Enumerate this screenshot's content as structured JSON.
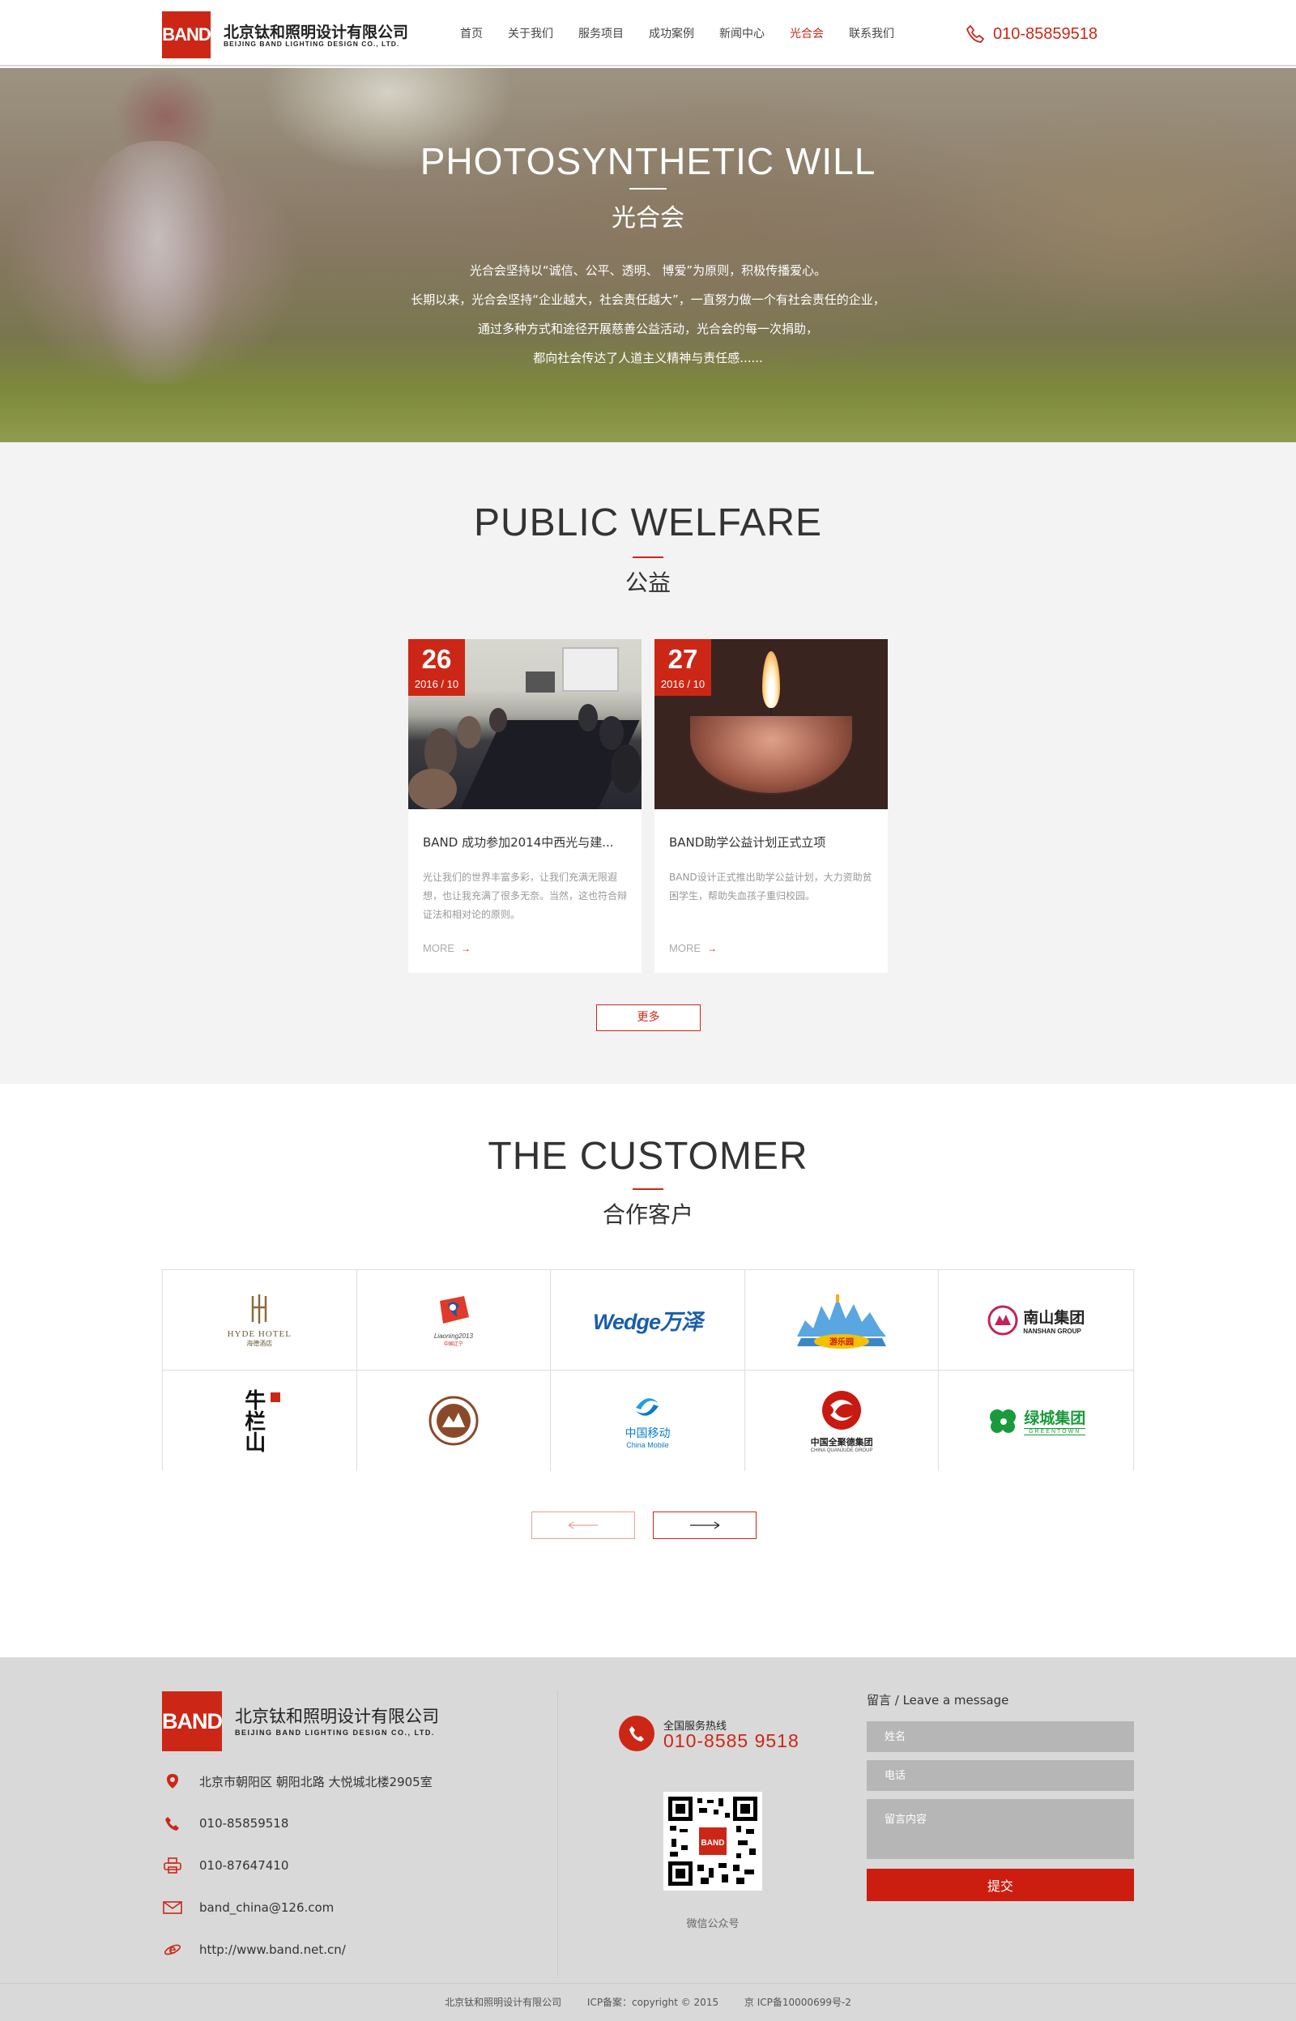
{
  "header": {
    "logo_text": "BAND",
    "company_cn": "北京钛和照明设计有限公司",
    "company_en": "BEIJING BAND LIGHTING DESIGN CO., LTD.",
    "nav": [
      "首页",
      "关于我们",
      "服务项目",
      "成功案例",
      "新闻中心",
      "光合会",
      "联系我们"
    ],
    "active_nav": "光合会",
    "hotline": "010-85859518"
  },
  "hero": {
    "title": "PHOTOSYNTHETIC WILL",
    "subtitle": "光合会",
    "lines": [
      "光合会坚持以“诚信、公平、透明、 博爱”为原则，积极传播爱心。",
      "长期以来，光合会坚持“企业越大，社会责任越大”，一直努力做一个有社会责任的企业，",
      "通过多种方式和途径开展慈善公益活动，光合会的每一次捐助，",
      "都向社会传达了人道主义精神与责任感......"
    ]
  },
  "welfare": {
    "title": "PUBLIC WELFARE",
    "subtitle": "公益",
    "cards": [
      {
        "day": "26",
        "year_month": "2016 / 10",
        "title": "BAND 成功参加2014中西光与建...",
        "desc": "光让我们的世界丰富多彩，让我们充满无限遐想，也让我充满了很多无奈。当然，这也符合辩证法和相对论的原则。",
        "more": "MORE"
      },
      {
        "day": "27",
        "year_month": "2016 / 10",
        "title": "BAND助学公益计划正式立项",
        "desc": "BAND设计正式推出助学公益计划，大力资助贫困学生，帮助失血孩子重归校园。",
        "more": "MORE"
      }
    ],
    "more_button": "更多"
  },
  "customer": {
    "title": "THE CUSTOMER",
    "subtitle": "合作客户",
    "logos": {
      "hyde_en": "HYDE HOTEL",
      "hyde_cn": "海德酒店",
      "liaoning": "Liaoning2013",
      "liaoning_sub": "中国辽宁",
      "wedge": "Wedge万泽",
      "park": "游乐园",
      "nanshan_cn": "南山集团",
      "nanshan_en": "NANSHAN GROUP",
      "niu": "牛栏山",
      "china_mobile_cn": "中国移动",
      "china_mobile_en": "China Mobile",
      "quanjude_cn": "中国全聚德集团",
      "quanjude_en": "CHINA QUANJUDE GROUP",
      "greentown_cn": "绿城集团",
      "greentown_en": "GREENTOWN"
    }
  },
  "footer": {
    "logo_text": "BAND",
    "company_cn": "北京钛和照明设计有限公司",
    "company_en": "BEIJING BAND LIGHTING DESIGN CO., LTD.",
    "address": "北京市朝阳区 朝阳北路 大悦城北楼2905室",
    "phone": "010-85859518",
    "fax": "010-87647410",
    "email": "band_china@126.com",
    "website": "http://www.band.net.cn/",
    "hotline_label": "全国服务热线",
    "hotline": "010-8585 9518",
    "qr_label": "微信公众号",
    "message_title": "留言 / Leave a message",
    "name_placeholder": "姓名",
    "phone_placeholder": "电话",
    "content_placeholder": "留言内容",
    "submit": "提交"
  },
  "copyright": {
    "company": "北京钛和照明设计有限公司",
    "icp_copy": "ICP备案：copyright © 2015",
    "icp_no": "京 ICP备10000699号-2"
  },
  "colors": {
    "brand_red": "#cc2716",
    "section_gray": "#f3f3f3",
    "footer_gray": "#d9d9d9"
  }
}
